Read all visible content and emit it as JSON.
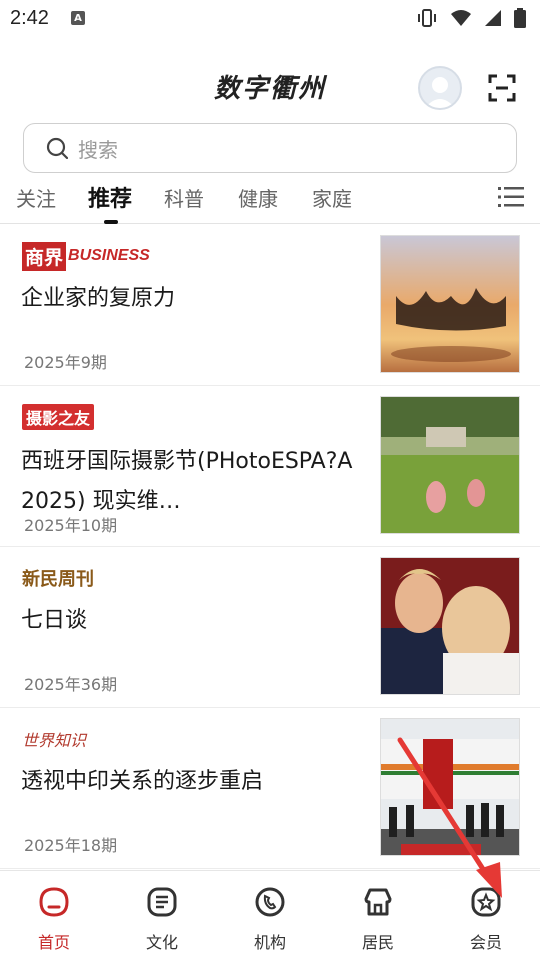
{
  "status_bar": {
    "time": "2:42",
    "notification_badge": "A",
    "icons": [
      "vibrate-icon",
      "wifi-icon",
      "signal-icon",
      "battery-icon"
    ]
  },
  "header": {
    "app_title": "数字衢州"
  },
  "search": {
    "placeholder": "搜索"
  },
  "tabs": [
    {
      "label": "关注"
    },
    {
      "label": "推荐",
      "active": true
    },
    {
      "label": "科普"
    },
    {
      "label": "健康"
    },
    {
      "label": "家庭"
    }
  ],
  "articles": [
    {
      "brand_cn": "商界",
      "brand_en": "BUSINESS",
      "title": "企业家的复原力",
      "issue": "2025年9期"
    },
    {
      "brand_cn": "摄影之友",
      "title": "西班牙国际摄影节(PHotoESPA?A 2025) 现实维…",
      "issue": "2025年10期"
    },
    {
      "brand_cn": "新民周刊",
      "title": "七日谈",
      "issue": "2025年36期"
    },
    {
      "brand_cn": "世界知识",
      "title": "透视中印关系的逐步重启",
      "issue": "2025年18期"
    }
  ],
  "bottom_nav": [
    {
      "label": "首页",
      "icon": "home-icon",
      "active": true
    },
    {
      "label": "文化",
      "icon": "culture-icon"
    },
    {
      "label": "机构",
      "icon": "phone-icon"
    },
    {
      "label": "居民",
      "icon": "residents-icon"
    },
    {
      "label": "会员",
      "icon": "member-icon"
    }
  ],
  "colors": {
    "accent": "#c62828",
    "annotation_arrow": "#e53935"
  }
}
